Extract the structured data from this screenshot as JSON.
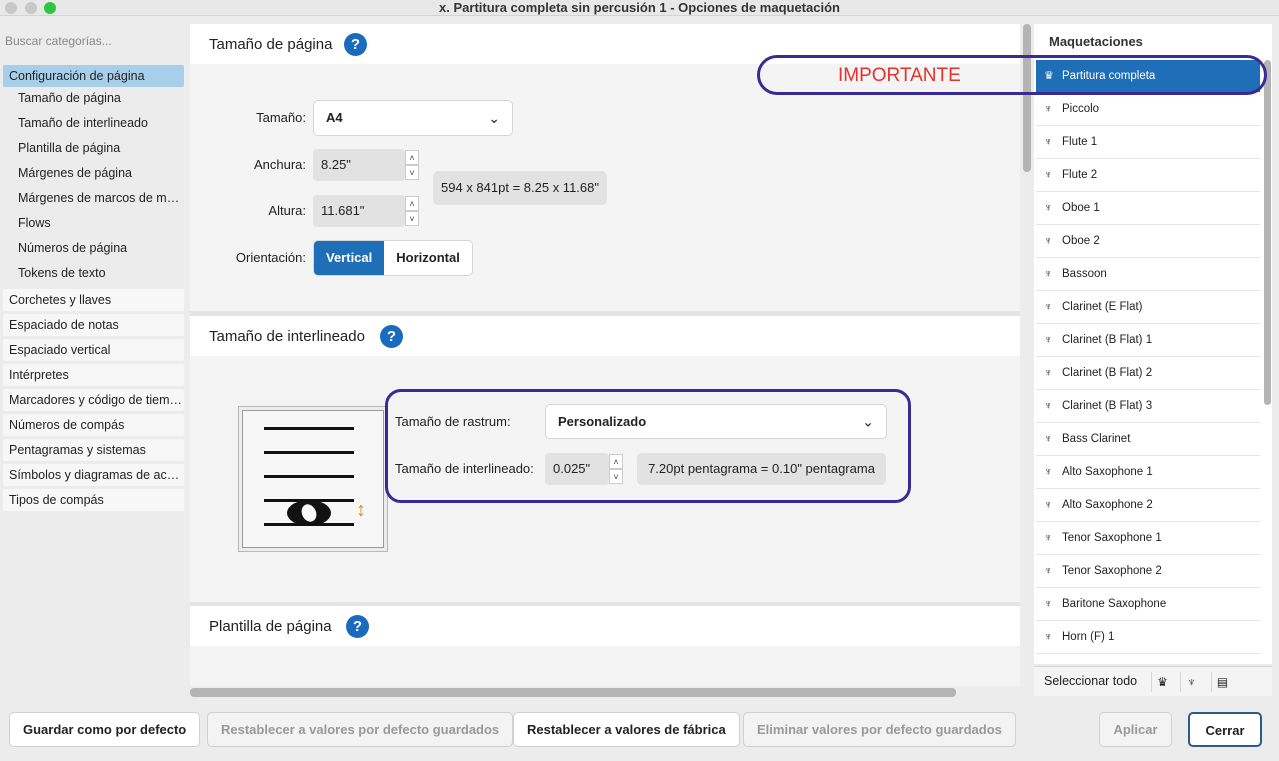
{
  "window": {
    "title": "x. Partitura completa sin percusión 1 - Opciones de maquetación",
    "controls": [
      "close",
      "minimize",
      "zoom"
    ]
  },
  "sidebar": {
    "search_placeholder": "Buscar categorías...",
    "active_category": "Configuración de página",
    "subitems": [
      "Tamaño de página",
      "Tamaño de interlineado",
      "Plantilla de página",
      "Márgenes de página",
      "Márgenes de marcos de mú…",
      "Flows",
      "Números de página",
      "Tokens de texto"
    ],
    "categories": [
      "Corchetes y llaves",
      "Espaciado de notas",
      "Espaciado vertical",
      "Intérpretes",
      "Marcadores y código de tiem…",
      "Números de compás",
      "Pentagramas y sistemas",
      "Símbolos y diagramas de ac…",
      "Tipos de compás"
    ]
  },
  "page_size": {
    "heading": "Tamaño de página",
    "size_label": "Tamaño:",
    "size_value": "A4",
    "width_label": "Anchura:",
    "width_value": "8.25\"",
    "height_label": "Altura:",
    "height_value": "11.681\"",
    "dimensions_info": "594 x 841pt = 8.25 x 11.68\"",
    "orientation_label": "Orientación:",
    "orientation_options": [
      "Vertical",
      "Horizontal"
    ],
    "orientation_selected": "Vertical"
  },
  "staff_size": {
    "heading": "Tamaño de interlineado",
    "rastrum_label": "Tamaño de rastrum:",
    "rastrum_value": "Personalizado",
    "spacing_label": "Tamaño de interlineado:",
    "spacing_value": "0.025\"",
    "spacing_info": "7.20pt pentagrama = 0.10\" pentagrama"
  },
  "page_template": {
    "heading": "Plantilla de página"
  },
  "layouts": {
    "title": "Maquetaciones",
    "items": [
      "Partitura completa",
      "Piccolo",
      "Flute 1",
      "Flute 2",
      "Oboe 1",
      "Oboe 2",
      "Bassoon",
      "Clarinet (E Flat)",
      "Clarinet (B Flat) 1",
      "Clarinet (B Flat) 2",
      "Clarinet (B Flat) 3",
      "Bass Clarinet",
      "Alto Saxophone 1",
      "Alto Saxophone 2",
      "Tenor Saxophone 1",
      "Tenor Saxophone 2",
      "Baritone Saxophone",
      "Horn (F) 1"
    ],
    "selected": "Partitura completa",
    "select_all": "Seleccionar todo",
    "filter_icons": [
      "full-score-icon",
      "part-icon",
      "custom-score-icon"
    ]
  },
  "annotation": {
    "text": "IMPORTANTE",
    "color": "#e3312b",
    "outline_color": "#3a2a95"
  },
  "footer": {
    "save_default": "Guardar como por defecto",
    "reset_saved": "Restablecer a valores por defecto guardados",
    "reset_factory": "Restablecer a valores de fábrica",
    "delete_saved": "Eliminar valores por defecto guardados",
    "apply": "Aplicar",
    "close": "Cerrar"
  },
  "colors": {
    "accent": "#1f6fb8",
    "sidebar_active": "#a7cfe9",
    "help_icon": "#1a6bbd"
  }
}
